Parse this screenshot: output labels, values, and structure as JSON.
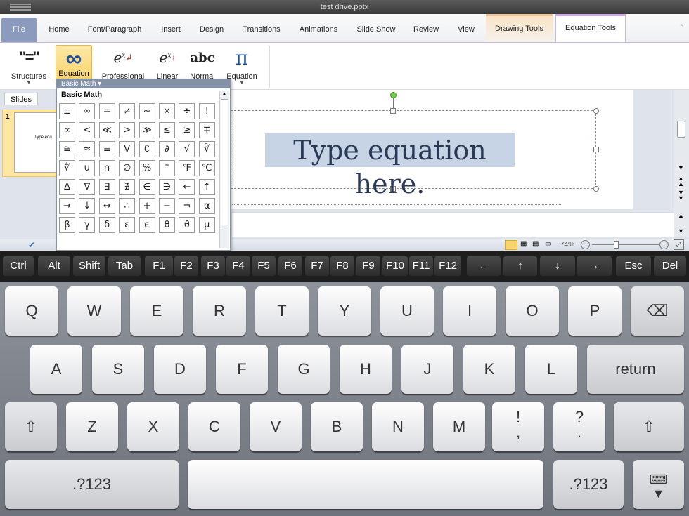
{
  "window": {
    "title": "test drive.pptx"
  },
  "tabs": [
    "File",
    "Home",
    "Font/Paragraph",
    "Insert",
    "Design",
    "Transitions",
    "Animations",
    "Slide Show",
    "Review",
    "View"
  ],
  "context_tabs": {
    "drawing": "Drawing Tools",
    "equation": "Equation Tools"
  },
  "ribbon": {
    "structures": "Structures",
    "equation": "Equation",
    "professional": "Professional",
    "linear": "Linear",
    "normal": "Normal",
    "equation2": "Equation",
    "normal_icon_text": "abc"
  },
  "panel": {
    "slides_tab": "Slides",
    "slide_number": "1",
    "thumb_text": "Type equ..."
  },
  "slide": {
    "equation_text": "Type equation here."
  },
  "status": {
    "zoom": "74%"
  },
  "gallery": {
    "header": "Basic Math",
    "title": "Basic Math",
    "symbols": [
      "±",
      "∞",
      "=",
      "≠",
      "~",
      "×",
      "÷",
      "!",
      "∝",
      "<",
      "≪",
      ">",
      "≫",
      "≤",
      "≥",
      "∓",
      "≅",
      "≈",
      "≡",
      "∀",
      "∁",
      "∂",
      "√",
      "∛",
      "∜",
      "∪",
      "∩",
      "∅",
      "%",
      "°",
      "℉",
      "℃",
      "∆",
      "∇",
      "∃",
      "∄",
      "∈",
      "∋",
      "←",
      "↑",
      "→",
      "↓",
      "↔",
      "∴",
      "+",
      "−",
      "¬",
      "α",
      "β",
      "γ",
      "δ",
      "ε",
      "ϵ",
      "θ",
      "ϑ",
      "μ"
    ]
  },
  "fnkeys": [
    "Ctrl",
    "Alt",
    "Shift",
    "Tab",
    "F1",
    "F2",
    "F3",
    "F4",
    "F5",
    "F6",
    "F7",
    "F8",
    "F9",
    "F10",
    "F11",
    "F12",
    "←",
    "↑",
    "↓",
    "→",
    "Esc",
    "Del"
  ],
  "keyboard": {
    "row1": [
      "Q",
      "W",
      "E",
      "R",
      "T",
      "Y",
      "U",
      "I",
      "O",
      "P"
    ],
    "row2": [
      "A",
      "S",
      "D",
      "F",
      "G",
      "H",
      "J",
      "K",
      "L"
    ],
    "return": "return",
    "row3": [
      "Z",
      "X",
      "C",
      "V",
      "B",
      "N",
      "M"
    ],
    "excl": "!",
    "comma": ",",
    "question": "?",
    "period": ".",
    "numkey": ".?123",
    "backspace": "⌫",
    "shift": "⇧"
  }
}
